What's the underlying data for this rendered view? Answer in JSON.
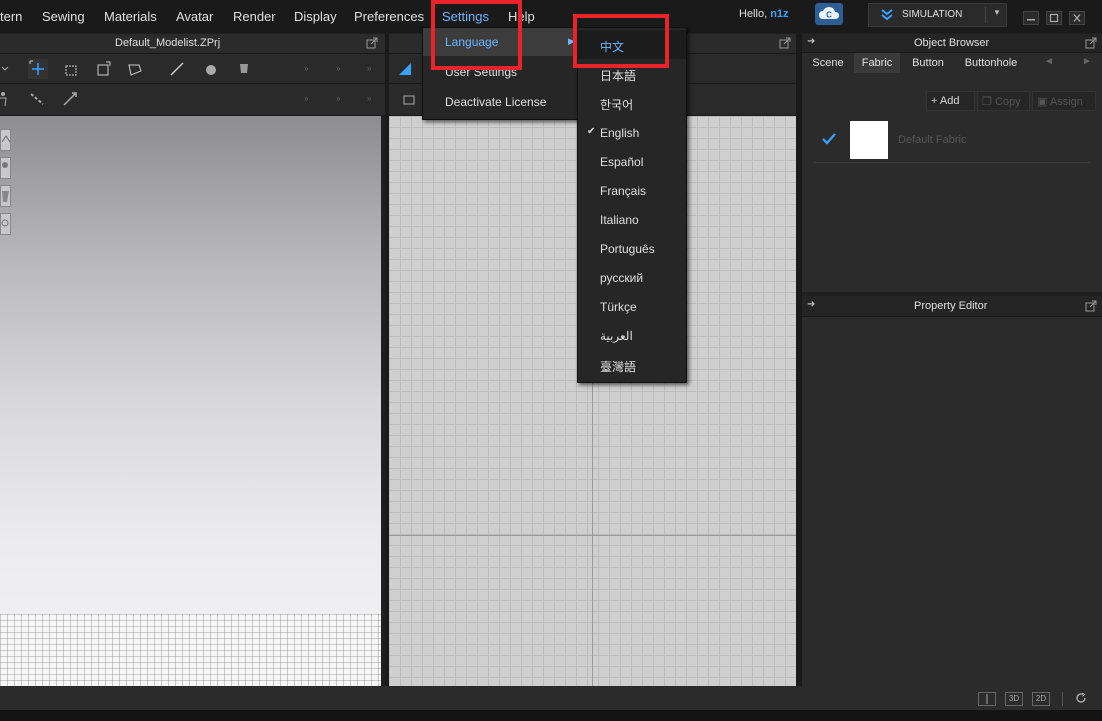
{
  "menubar": {
    "items": [
      "tern",
      "Sewing",
      "Materials",
      "Avatar",
      "Render",
      "Display",
      "Preferences",
      "Settings",
      "Help"
    ],
    "greeting": "Hello,",
    "username": "n1z",
    "mode_label": "SIMULATION"
  },
  "panels": {
    "view3d_title": "Default_Modelist.ZPrj",
    "object_browser": {
      "title": "Object Browser",
      "tabs": [
        "Scene",
        "Fabric",
        "Button",
        "Buttonhole"
      ],
      "add_label": "Add",
      "copy_label": "Copy",
      "assign_label": "Assign",
      "fabric_item": "Default Fabric"
    },
    "property_editor_title": "Property Editor"
  },
  "settings_menu": {
    "items": [
      "Language",
      "User Settings",
      "Deactivate License"
    ]
  },
  "language_menu": {
    "items": [
      "中文",
      "日本語",
      "한국어",
      "English",
      "Español",
      "Français",
      "Italiano",
      "Português",
      "русский",
      "Türkçe",
      "العربية",
      "臺灣語"
    ],
    "checked": "English",
    "highlighted": "中文"
  },
  "status_bar": {
    "btn_3d": "3D",
    "btn_2d": "2D"
  },
  "colors": {
    "accent": "#37a3ff",
    "highlight_box": "#e8232a"
  }
}
